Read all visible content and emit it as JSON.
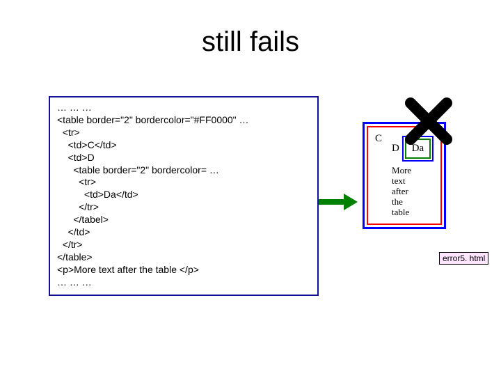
{
  "title": "still fails",
  "code": {
    "l1": "… … …",
    "l2": "<table border=\"2\" bordercolor=\"#FF0000\" …",
    "l3": "  <tr>",
    "l4": "    <td>C</td>",
    "l5": "    <td>D",
    "l6": "      <table border=\"2\" bordercolor= …",
    "l7": "        <tr>",
    "l8": "          <td>Da</td>",
    "l9": "        </tr>",
    "l10": "      </tabel>",
    "l11": "    </td>",
    "l12": "  </tr>",
    "l13": "</table>",
    "l14": "<p>More text after the table </p>",
    "l15": "… … …"
  },
  "render": {
    "c": "C",
    "d": "D",
    "da": "Da",
    "more": "More text after the table"
  },
  "filename": "error5. html",
  "icons": {
    "cross": "cross-icon",
    "arrow": "arrow-icon"
  },
  "colors": {
    "codebox_border": "#10109c",
    "outer_border": "#0000ff",
    "table_border": "#ff0000",
    "inner_border": "#008000",
    "arrow_fill": "#008000",
    "filename_bg": "#ffe5ff"
  }
}
